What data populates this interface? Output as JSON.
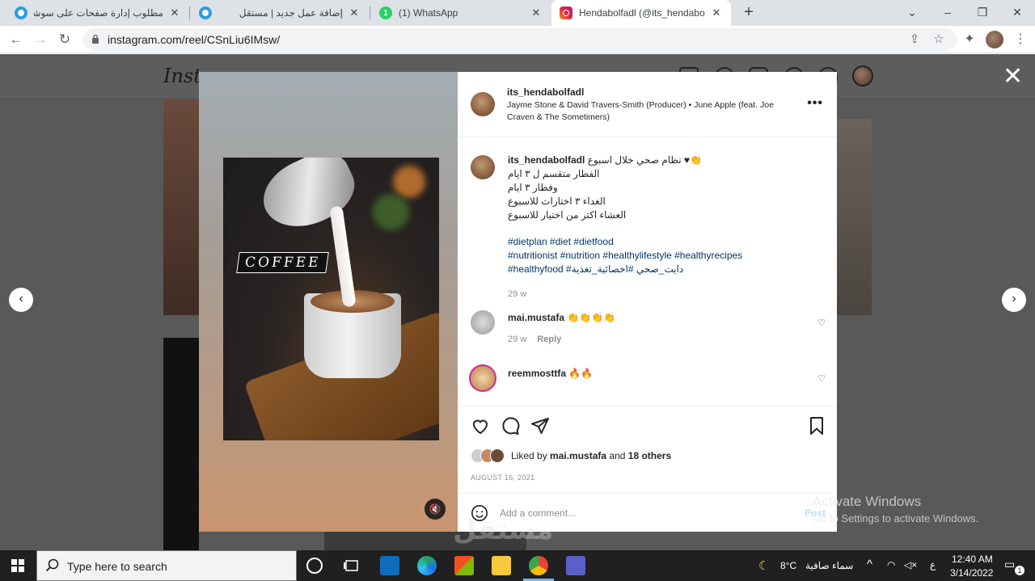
{
  "browser": {
    "tabs": [
      {
        "title": "مطلوب إدارة صفحات على سوشيال",
        "active": false,
        "icon": "mostaql-icon"
      },
      {
        "title": "إضافة عمل جديد | مستقل",
        "active": false,
        "icon": "mostaql-icon"
      },
      {
        "title": "(1) WhatsApp",
        "active": false,
        "icon": "whatsapp-icon",
        "badge": "1"
      },
      {
        "title": "Hendabolfadl (@its_hendabolfadl",
        "active": true,
        "icon": "instagram-icon"
      }
    ],
    "url": "instagram.com/reel/CSnLiu6IMsw/"
  },
  "instagram": {
    "logo_text": "Insta",
    "post": {
      "username": "its_hendabolfadl",
      "audio": "Jayme Stone & David Travers-Smith (Producer) • June Apple (feat. Joe Craven & The Sometimers)",
      "media_overlay_text": "COFFEE",
      "caption_username": "its_hendabolfadl",
      "caption_lines": [
        "نظام صحي خلال اسبوع ♥👏",
        "الفطار متقسم ل ٣ ايام",
        "وفطار ٣ ايام",
        "الغداء ٣ اختارات للاسبوع",
        "العشاء اكتر من اختيار للاسبوع"
      ],
      "hashtags": [
        "#dietplan #diet #dietfood",
        "#nutritionist #nutrition #healthylifestyle #healthyrecipes",
        "#healthyfood #دايت_صحي #اخصائية_تغذية"
      ],
      "caption_time": "29 w",
      "comments": [
        {
          "username": "mai.mustafa",
          "text": "👏👏👏👏",
          "time": "29 w",
          "reply_label": "Reply"
        },
        {
          "username": "reemmosttfa",
          "text": "🔥🔥"
        }
      ],
      "liked_by_prefix": "Liked by",
      "liked_by_user": "mai.mustafa",
      "liked_by_and": "and",
      "liked_by_others": "18 others",
      "date": "AUGUST 16, 2021",
      "add_comment_placeholder": "Add a comment...",
      "post_label": "Post"
    }
  },
  "windows": {
    "activate_title": "Activate Windows",
    "activate_sub": "Go to Settings to activate Windows.",
    "search_placeholder": "Type here to search",
    "weather_temp": "8°C",
    "weather_text": "سماء صافية",
    "lang": "ع",
    "time": "12:40 AM",
    "date": "3/14/2022",
    "notification_count": "1"
  },
  "watermark_text": "مستقل",
  "colors": {
    "instagram_link": "#00376b",
    "post_button": "#b2dffc",
    "taskbar": "#202020"
  }
}
